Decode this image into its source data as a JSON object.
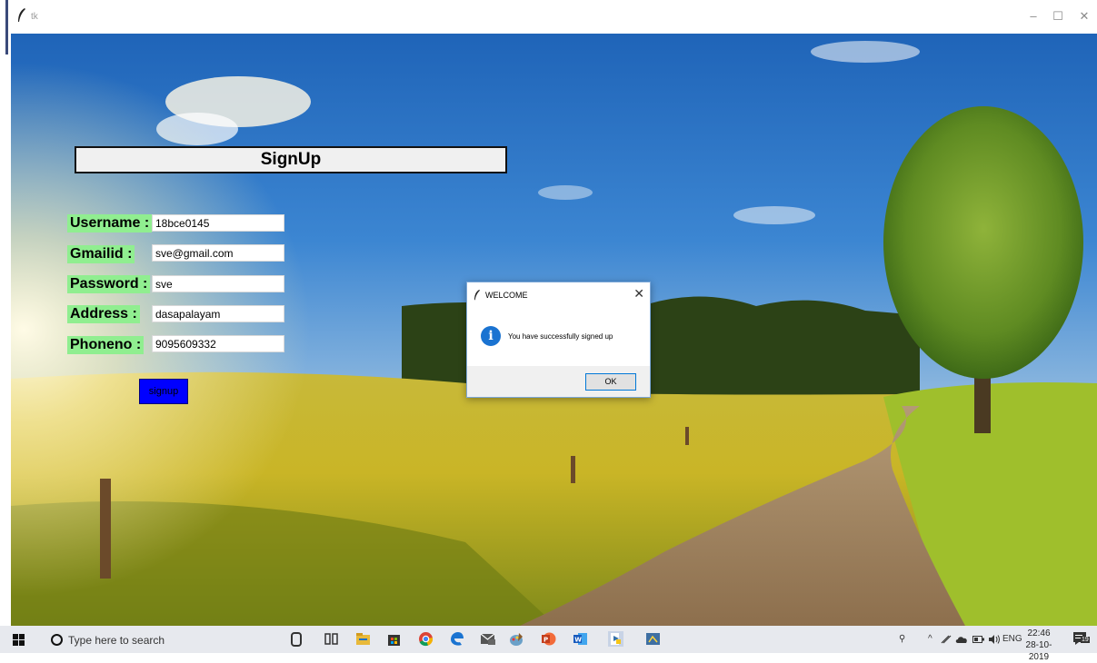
{
  "window": {
    "title": "tk",
    "minimize_glyph": "–",
    "maximize_glyph": "☐",
    "close_glyph": "✕"
  },
  "form": {
    "heading": "SignUp",
    "fields": [
      {
        "label": "Username :",
        "value": "18bce0145"
      },
      {
        "label": "Gmailid :",
        "value": "sve@gmail.com"
      },
      {
        "label": "Password :",
        "value": "sve"
      },
      {
        "label": "Address :",
        "value": "dasapalayam"
      },
      {
        "label": "Phoneno :",
        "value": "9095609332"
      }
    ],
    "submit_label": "signup",
    "label_color": "#90ee90",
    "button_color": "#0000ff"
  },
  "dialog": {
    "title": "WELCOME",
    "message": "You have successfully signed up",
    "ok_label": "OK",
    "info_glyph": "i",
    "close_glyph": "✕"
  },
  "taskbar": {
    "search_placeholder": "Type here to search",
    "apps": [
      "task-view-icon",
      "file-explorer-icon",
      "store-icon",
      "chrome-icon",
      "edge-icon",
      "mail-icon",
      "paint-icon",
      "powerpoint-icon",
      "word-icon",
      "python-idle-icon",
      "python-window-icon"
    ],
    "tray": {
      "people_glyph": "⚲",
      "chevron_glyph": "^",
      "language": "ENG",
      "time": "22:46",
      "date": "28-10-2019",
      "notification_count": "19"
    }
  }
}
